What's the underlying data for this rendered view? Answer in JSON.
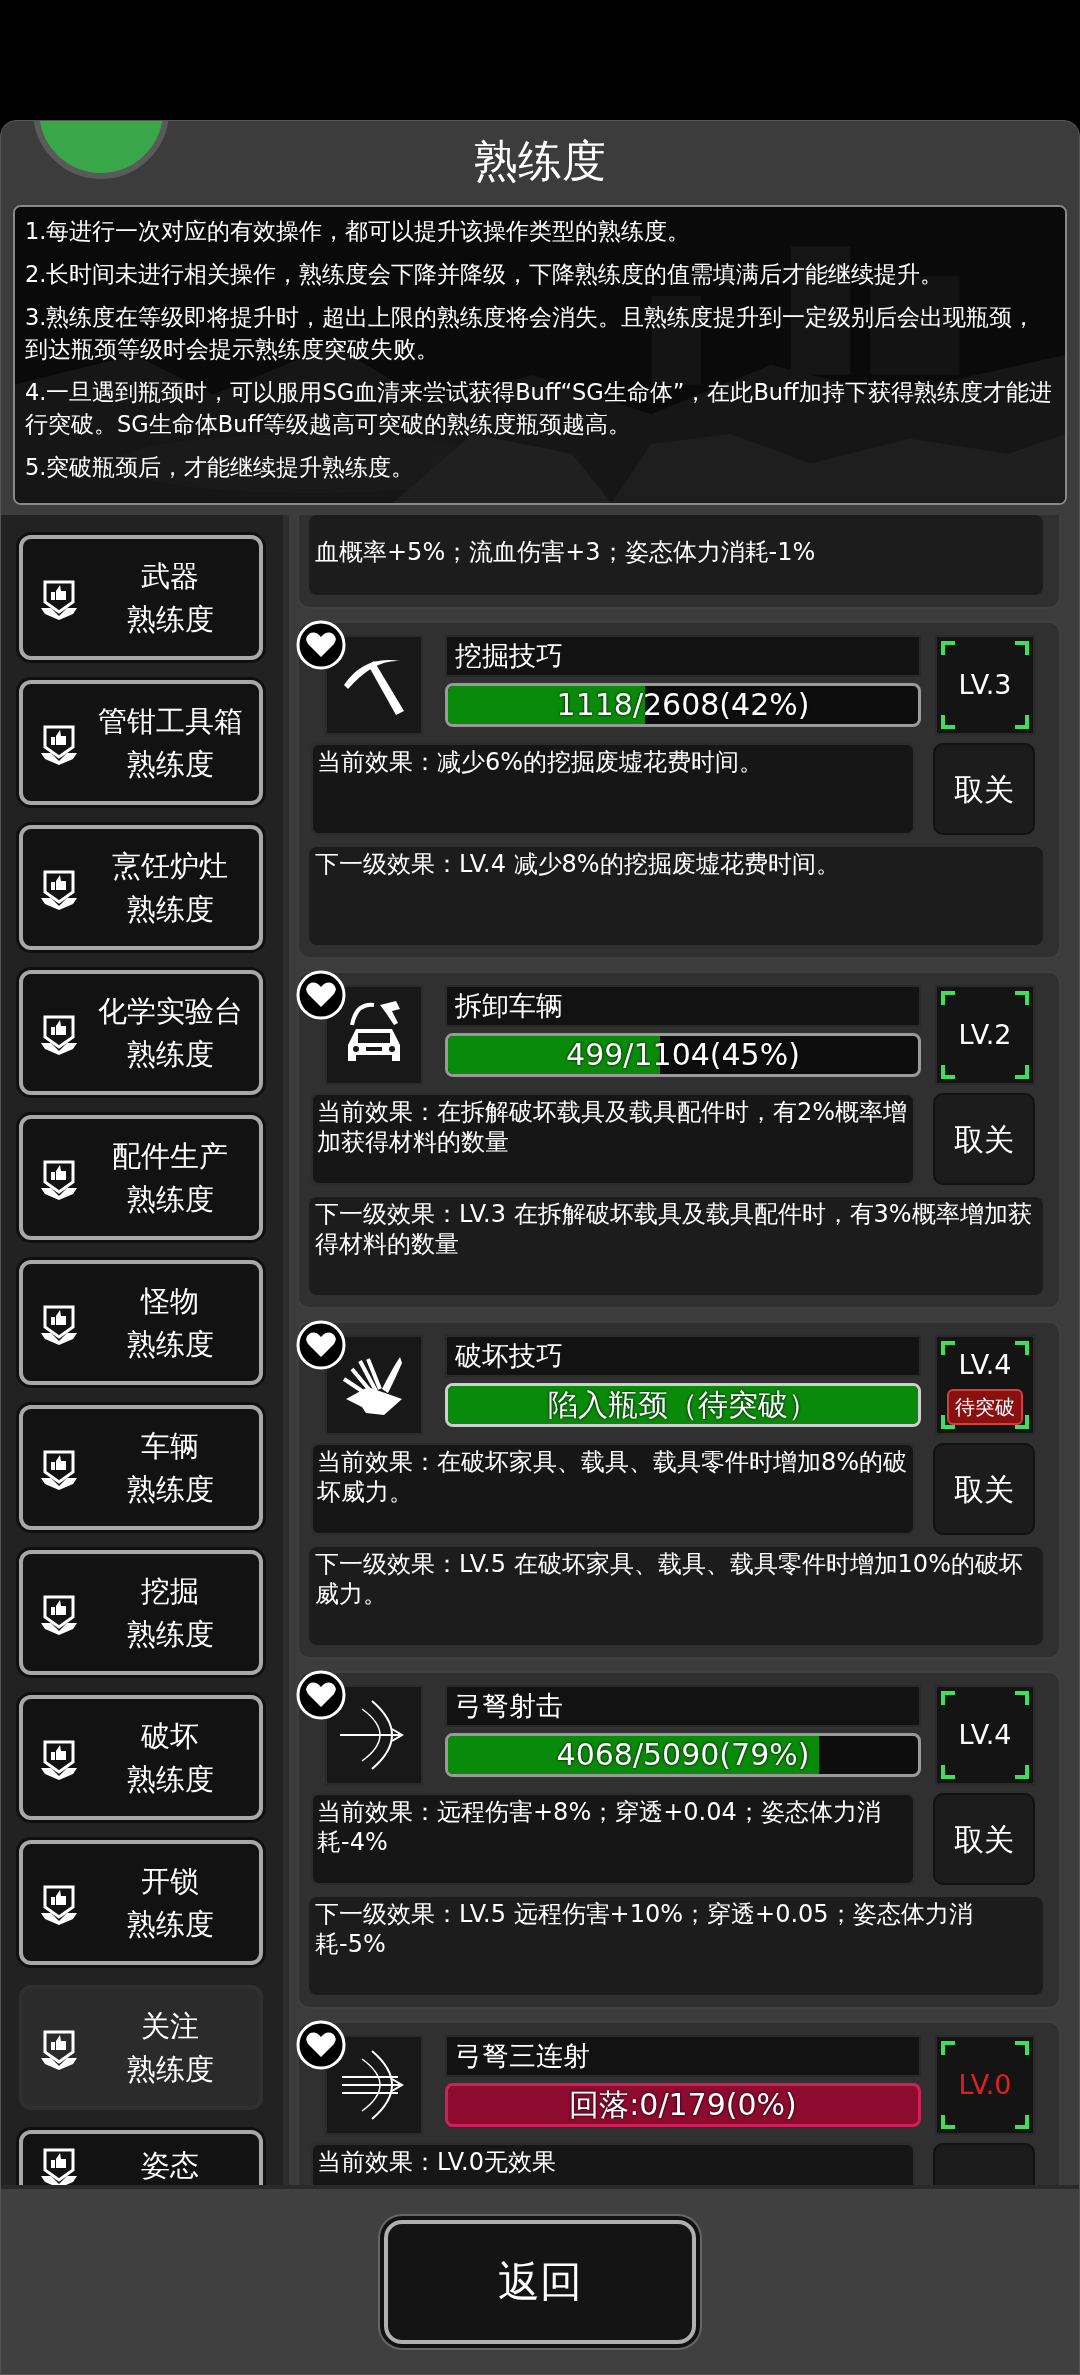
{
  "title": "熟练度",
  "rules": [
    "1.每进行一次对应的有效操作，都可以提升该操作类型的熟练度。",
    "2.长时间未进行相关操作，熟练度会下降并降级，下降熟练度的值需填满后才能继续提升。",
    "3.熟练度在等级即将提升时，超出上限的熟练度将会消失。且熟练度提升到一定级别后会出现瓶颈，到达瓶颈等级时会提示熟练度突破失败。",
    "4.一旦遇到瓶颈时，可以服用SG血清来尝试获得Buff“SG生命体”，在此Buff加持下获得熟练度才能进行突破。SG生命体Buff等级越高可突破的熟练度瓶颈越高。",
    "5.突破瓶颈后，才能继续提升熟练度。"
  ],
  "sidebar": {
    "items": [
      {
        "name": "武器",
        "label": "熟练度",
        "selected": false
      },
      {
        "name": "管钳工具箱",
        "label": "熟练度",
        "selected": false
      },
      {
        "name": "烹饪炉灶",
        "label": "熟练度",
        "selected": false
      },
      {
        "name": "化学实验台",
        "label": "熟练度",
        "selected": false
      },
      {
        "name": "配件生产",
        "label": "熟练度",
        "selected": false
      },
      {
        "name": "怪物",
        "label": "熟练度",
        "selected": false
      },
      {
        "name": "车辆",
        "label": "熟练度",
        "selected": false
      },
      {
        "name": "挖掘",
        "label": "熟练度",
        "selected": false
      },
      {
        "name": "破坏",
        "label": "熟练度",
        "selected": false
      },
      {
        "name": "开锁",
        "label": "熟练度",
        "selected": false
      },
      {
        "name": "关注",
        "label": "熟练度",
        "selected": true
      },
      {
        "name": "姿态",
        "selected": false
      }
    ]
  },
  "skills": [
    {
      "kind": "stub",
      "next_effect": "血概率+5%；流血伤害+3；姿态体力消耗-1%"
    },
    {
      "kind": "full",
      "name": "挖掘技巧",
      "bottleneck": false,
      "falling": false,
      "level": 0.42,
      "progress": "1118/2608(42%)",
      "lv": "LV.3",
      "current_effect": "当前效果：减少6%的挖掘废墟花费时间。",
      "button": "取关",
      "next_effect": "下一级效果：LV.4 减少8%的挖掘废墟花费时间。"
    },
    {
      "kind": "full",
      "name": "拆卸车辆",
      "bottleneck": false,
      "falling": false,
      "level": 0.45,
      "progress": "499/1104(45%)",
      "lv": "LV.2",
      "current_effect": "当前效果：在拆解破坏载具及载具配件时，有2%概率增加获得材料的数量",
      "button": "取关",
      "next_effect": "下一级效果：LV.3 在拆解破坏载具及载具配件时，有3%概率增加获得材料的数量"
    },
    {
      "kind": "full",
      "name": "破坏技巧",
      "bottleneck": true,
      "falling": false,
      "level": 1,
      "progress": "陷入瓶颈（待突破）",
      "lv": "LV.4",
      "badge": "待突破",
      "current_effect": "当前效果：在破坏家具、载具、载具零件时增加8%的破坏威力。",
      "button": "取关",
      "next_effect": "下一级效果：LV.5 在破坏家具、载具、载具零件时增加10%的破坏威力。"
    },
    {
      "kind": "full",
      "name": "弓弩射击",
      "bottleneck": false,
      "falling": false,
      "level": 0.79,
      "progress": "4068/5090(79%)",
      "lv": "LV.4",
      "current_effect": "当前效果：远程伤害+8%；穿透+0.04；姿态体力消耗-4%",
      "button": "取关",
      "next_effect": "下一级效果：LV.5 远程伤害+10%；穿透+0.05；姿态体力消耗-5%"
    },
    {
      "kind": "cut",
      "name": "弓弩三连射",
      "bottleneck": false,
      "falling": true,
      "progress": "回落:0/179(0%)",
      "lv": "LV.0",
      "current_effect": "当前效果：LV.0无效果"
    }
  ],
  "back_button": "返回"
}
